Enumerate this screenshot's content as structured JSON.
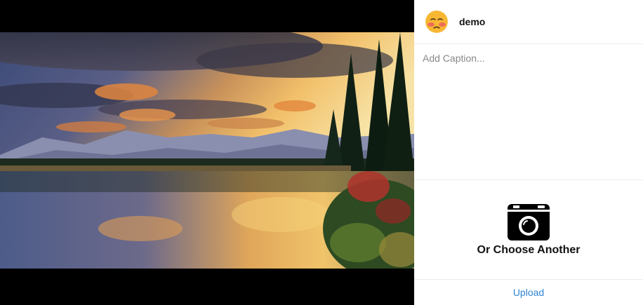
{
  "user": {
    "name": "demo",
    "avatar_icon": "sad-face-emoji-icon"
  },
  "caption": {
    "placeholder": "Add Caption...",
    "value": ""
  },
  "chooser": {
    "label": "Or Choose Another",
    "icon": "camera-icon"
  },
  "upload": {
    "label": "Upload",
    "color": "#2f86d6"
  },
  "theme": {
    "photo_background": "#000000",
    "divider": "#ececec"
  }
}
